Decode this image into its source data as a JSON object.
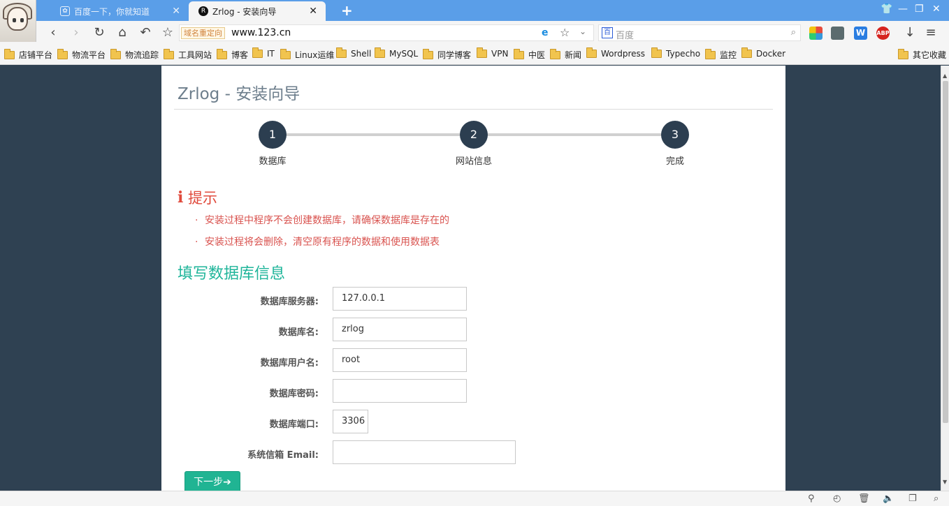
{
  "browser": {
    "tabs": [
      {
        "title": "百度一下，你就知道",
        "icon": "paw-icon",
        "close": "✕"
      },
      {
        "title": "Zrlog - 安装向导",
        "icon": "zrlog-favicon",
        "close": "✕"
      }
    ],
    "new_tab": "+",
    "window_controls": {
      "skin": "👕",
      "minimize": "—",
      "restore": "❐",
      "close": "✕"
    },
    "nav": {
      "back": "‹",
      "forward": "›",
      "reload": "↻",
      "home": "⌂",
      "undo": "↶",
      "bookmark": "☆"
    },
    "address": {
      "redirect_badge": "域名重定向",
      "url": "www.123.cn",
      "star": "☆",
      "dropdown": "⌄"
    },
    "search": {
      "engine_icon": "百",
      "placeholder": "百度",
      "button": "⌕"
    },
    "extensions": {
      "abp": "ABP",
      "word": "W",
      "download": "↓",
      "menu": "≡"
    },
    "bookmarks": [
      "店铺平台",
      "物流平台",
      "物流追踪",
      "工具网站",
      "博客",
      "IT",
      "Linux运维",
      "Shell",
      "MySQL",
      "同学博客",
      "VPN",
      "中医",
      "新闻",
      "Wordpress",
      "Typecho",
      "监控",
      "Docker"
    ],
    "bookmarks_other": "其它收藏"
  },
  "page": {
    "title": "Zrlog - 安装向导",
    "steps": [
      {
        "number": "1",
        "label": "数据库"
      },
      {
        "number": "2",
        "label": "网站信息"
      },
      {
        "number": "3",
        "label": "完成"
      }
    ],
    "tip": {
      "icon": "i",
      "title": "提示",
      "bullet": "·",
      "items": [
        "安装过程中程序不会创建数据库，请确保数据库是存在的",
        "安装过程将会删除，清空原有程序的数据和使用数据表"
      ]
    },
    "section_title": "填写数据库信息",
    "form": {
      "host": {
        "label": "数据库服务器:",
        "value": "127.0.0.1"
      },
      "dbname": {
        "label": "数据库名:",
        "value": "zrlog"
      },
      "user": {
        "label": "数据库用户名:",
        "value": "root"
      },
      "password": {
        "label": "数据库密码:",
        "value": ""
      },
      "port": {
        "label": "数据库端口:",
        "value": "3306"
      },
      "email": {
        "label": "系统信箱 Email:",
        "value": ""
      }
    },
    "next_button": "下一步➔"
  },
  "statusbar": {
    "icons": [
      "pin-icon",
      "speed-icon",
      "trash-icon",
      "sound-icon",
      "window-icon",
      "zoom-icon"
    ],
    "glyphs": [
      "⚲",
      "◴",
      "🗑",
      "🔈",
      "❐",
      "⌕"
    ]
  },
  "colors": {
    "accent_teal": "#1fb59a",
    "tip_red": "#e04a3c",
    "step_dark": "#2c3e50",
    "page_bg": "#2f4152",
    "tab_bar": "#5a9ee8"
  }
}
